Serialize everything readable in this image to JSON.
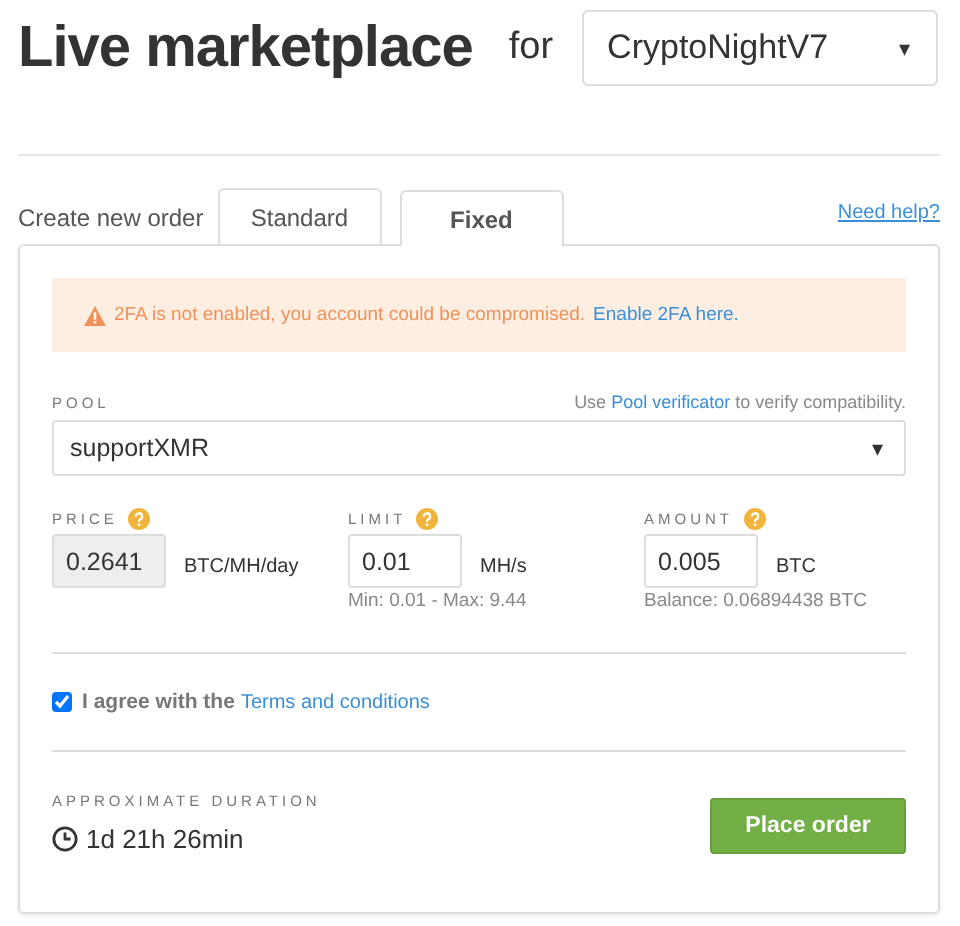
{
  "header": {
    "title": "Live marketplace",
    "connector": "for",
    "algorithm": {
      "value": "CryptoNightV7",
      "caret": "▾"
    }
  },
  "order": {
    "label": "Create new order",
    "tabs": [
      {
        "label": "Standard",
        "selected": false
      },
      {
        "label": "Fixed",
        "selected": true
      }
    ],
    "help": "Need help?"
  },
  "alert": {
    "text": "2FA is not enabled, you account could be compromised.",
    "link": "Enable 2FA here."
  },
  "pool": {
    "label": "POOL",
    "hint_before": "Use",
    "hint_link": "Pool verificator",
    "hint_after": "to verify compatibility.",
    "value": "supportXMR",
    "caret": "▾"
  },
  "fields": [
    {
      "label": "PRICE",
      "value": "0.2641",
      "unit": "BTC/MH/day",
      "disabled": true
    },
    {
      "label": "LIMIT",
      "value": "0.01",
      "unit": "MH/s",
      "note": "Min: 0.01 - Max: 9.44",
      "disabled": false
    },
    {
      "label": "AMOUNT",
      "value": "0.005",
      "unit": "BTC",
      "note": "Balance: 0.06894438 BTC",
      "disabled": false
    }
  ],
  "agree": {
    "checked": true,
    "text": "I agree with the",
    "link": "Terms and conditions"
  },
  "duration": {
    "label": "APPROXIMATE DURATION",
    "value": "1d 21h 26min"
  },
  "submit": "Place order"
}
